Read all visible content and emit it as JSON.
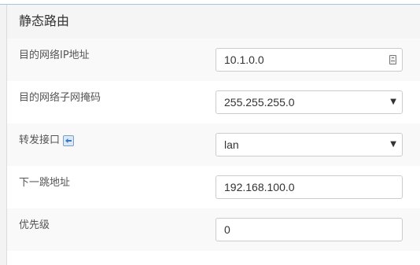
{
  "panel": {
    "title": "静态路由"
  },
  "fields": [
    {
      "label": "目的网络IP地址",
      "value": "10.1.0.0",
      "type": "text",
      "icon": "input-helper-icon"
    },
    {
      "label": "目的网络子网掩码",
      "value": "255.255.255.0",
      "type": "select"
    },
    {
      "label": "转发接口",
      "value": "lan",
      "type": "select",
      "icon": "interface-info-icon"
    },
    {
      "label": "下一跳地址",
      "value": "192.168.100.0",
      "type": "text"
    },
    {
      "label": "优先级",
      "value": "0",
      "type": "text"
    }
  ]
}
